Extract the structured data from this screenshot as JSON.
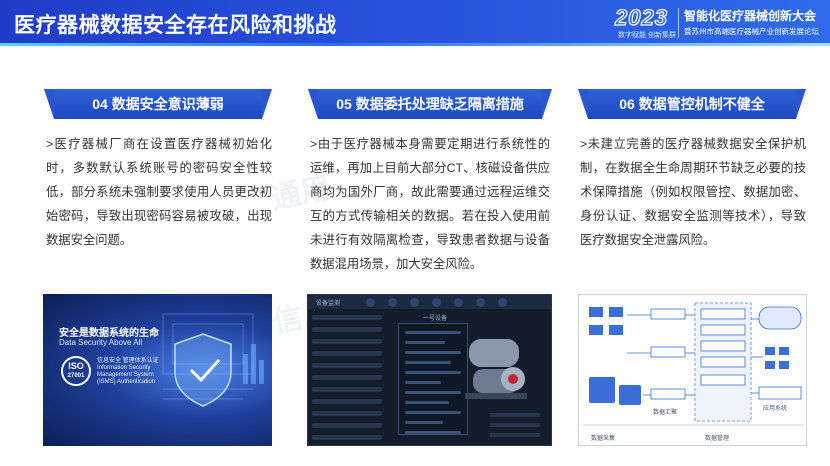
{
  "header": {
    "title": "医疗器械数据安全存在风险和挑战",
    "logo_year": "2023",
    "logo_slogan": "数字赋能 创新集群",
    "conference_name": "智能化医疗器械创新大会",
    "conference_sub": "暨苏州市高端医疗器械产业创新发展论坛"
  },
  "watermarks": [
    "通用",
    "信息"
  ],
  "columns": [
    {
      "title": "04 数据安全意识薄弱",
      "text": ">医疗器械厂商在设置医疗器械初始化时，多数默认系统账号的密码安全性较低，部分系统未强制要求使用人员更改初始密码，导致出现密码容易被攻破，出现数据安全问题。"
    },
    {
      "title": "05 数据委托处理缺乏隔离措施",
      "text": ">由于医疗器械本身需要定期进行系统性的运维，再加上目前大部分CT、核磁设备供应商均为国外厂商，故此需要通过远程运维交互的方式传输相关的数据。若在投入使用前未进行有效隔离检查，导致患者数据与设备数据混用场景，加大安全风险。"
    },
    {
      "title": "06 数据管控机制不健全",
      "text": ">未建立完善的医疗器械数据安全保护机制，在数据全生命周期环节缺乏必要的技术保障措施（例如权限管控、数据加密、身份认证、数据安全监测等技术），导致医疗数据安全泄露风险。"
    }
  ],
  "panel_security": {
    "headline": "安全是数据系统的生命",
    "headline_en": "Data Security Above All",
    "iso_top": "ISO",
    "iso_num": "27001",
    "iso_text_cn": "信息安全 管理体系认证",
    "iso_text_en": "Information Security Management System (ISMS) Authentication"
  },
  "panel_dashboard": {
    "top_label": "设备监测",
    "center_label": "一号设备"
  },
  "panel_diagram": {
    "labels": [
      "数据采集",
      "数据管理",
      "数据汇聚",
      "应用系统"
    ]
  }
}
